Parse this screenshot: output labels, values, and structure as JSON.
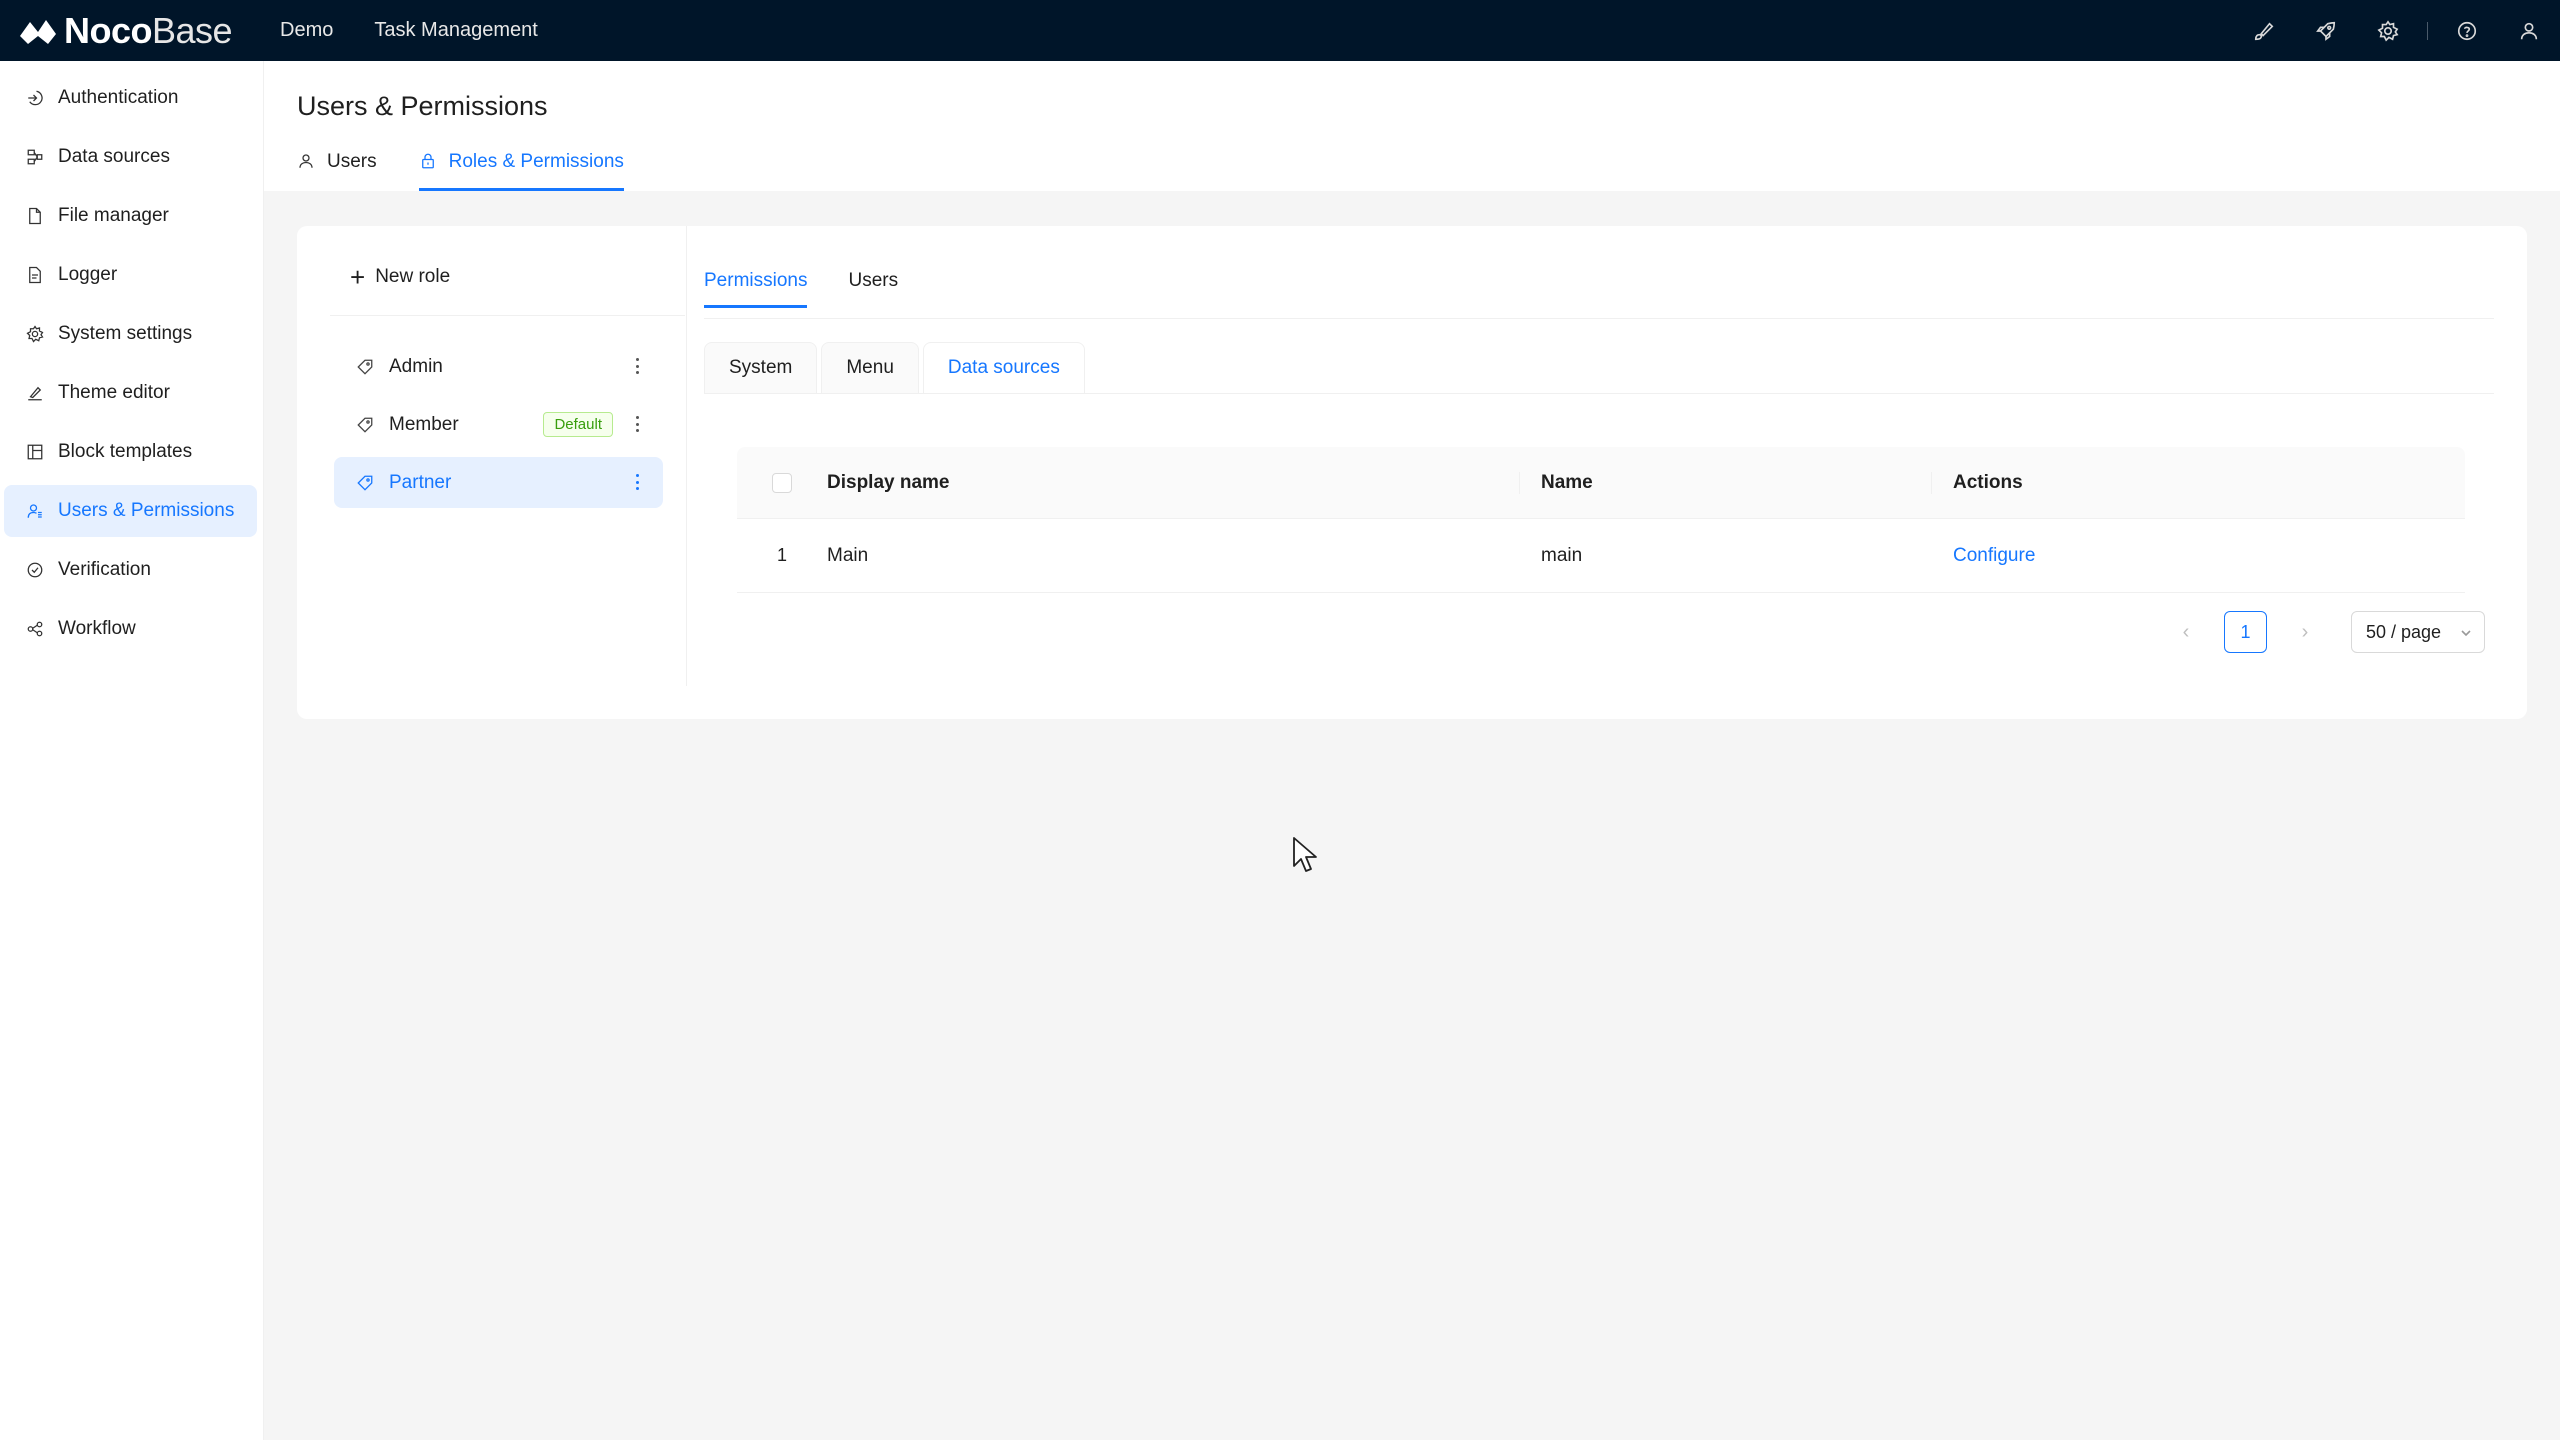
{
  "brand": {
    "part1": "Noco",
    "part2": "Base"
  },
  "topnav": [
    "Demo",
    "Task Management"
  ],
  "topicons": [
    "paint-brush-icon",
    "plugin-rocket-icon",
    "settings-gear-icon",
    "help-icon",
    "user-icon"
  ],
  "sidebar": {
    "items": [
      {
        "label": "Authentication",
        "icon": "login-icon"
      },
      {
        "label": "Data sources",
        "icon": "database-icon"
      },
      {
        "label": "File manager",
        "icon": "file-icon"
      },
      {
        "label": "Logger",
        "icon": "file-text-icon"
      },
      {
        "label": "System settings",
        "icon": "gear-icon"
      },
      {
        "label": "Theme editor",
        "icon": "brush-icon"
      },
      {
        "label": "Block templates",
        "icon": "layout-icon"
      },
      {
        "label": "Users & Permissions",
        "icon": "users-icon",
        "active": true
      },
      {
        "label": "Verification",
        "icon": "check-circle-icon"
      },
      {
        "label": "Workflow",
        "icon": "workflow-icon"
      }
    ]
  },
  "page": {
    "title": "Users & Permissions",
    "tabs": [
      {
        "label": "Users"
      },
      {
        "label": "Roles & Permissions",
        "active": true
      }
    ]
  },
  "roles": {
    "new_role_label": "New role",
    "items": [
      {
        "label": "Admin"
      },
      {
        "label": "Member",
        "badge": "Default"
      },
      {
        "label": "Partner",
        "active": true
      }
    ]
  },
  "permissions": {
    "tabs": [
      {
        "label": "Permissions",
        "active": true
      },
      {
        "label": "Users"
      }
    ],
    "subtabs": [
      {
        "label": "System"
      },
      {
        "label": "Menu"
      },
      {
        "label": "Data sources",
        "active": true
      }
    ],
    "table": {
      "columns": [
        "Display name",
        "Name",
        "Actions"
      ],
      "rows": [
        {
          "index": "1",
          "display_name": "Main",
          "name": "main",
          "action": "Configure"
        }
      ]
    },
    "pagination": {
      "current": "1",
      "page_size": "50 / page"
    }
  },
  "colors": {
    "primary": "#1677ff",
    "header_bg": "#001529",
    "active_bg": "#e6f0ff"
  }
}
